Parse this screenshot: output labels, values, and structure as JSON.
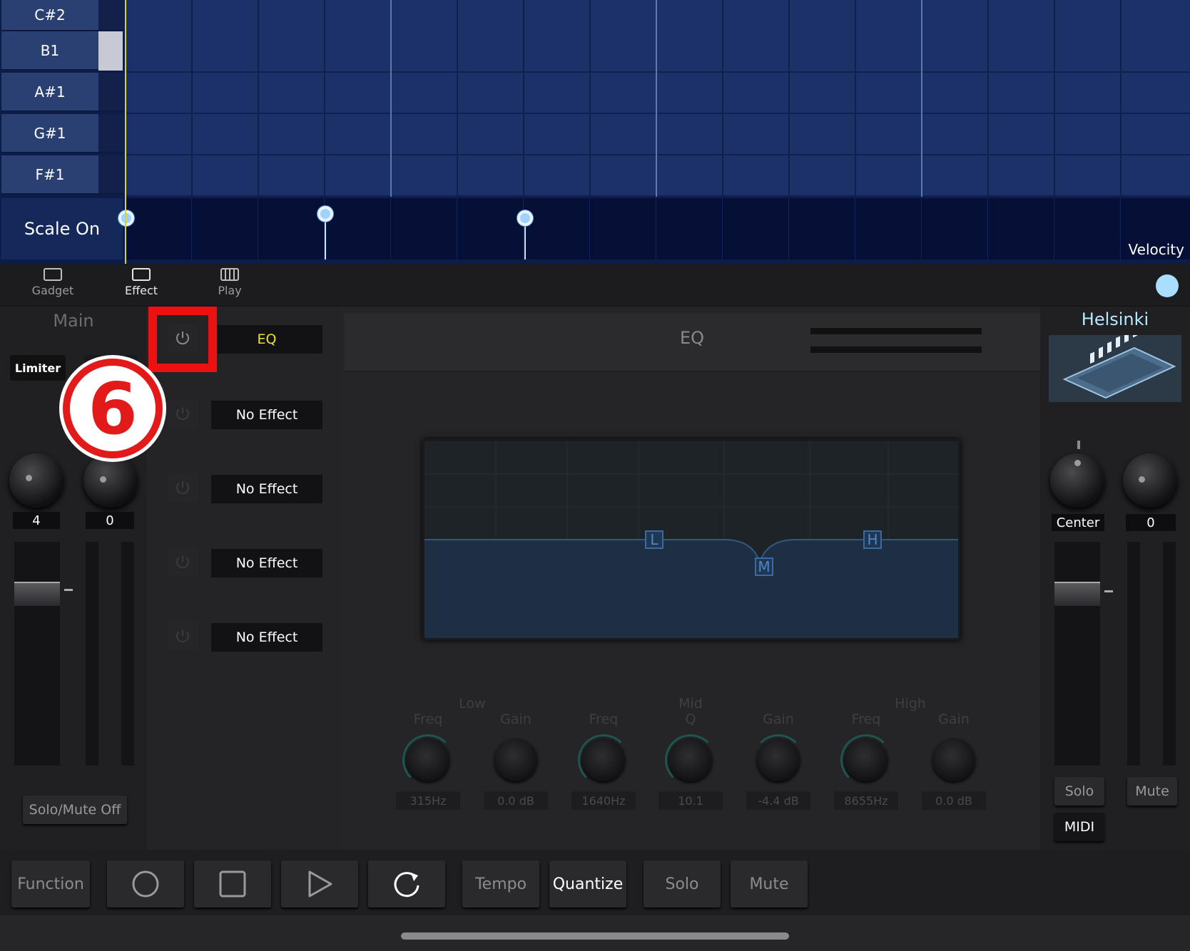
{
  "piano": {
    "keys": [
      "C#2",
      "B1",
      "A#1",
      "G#1",
      "F#1"
    ],
    "scale_button": "Scale On",
    "velocity_label": "Velocity"
  },
  "tabs": [
    {
      "label": "Gadget",
      "icon": "gadget-icon"
    },
    {
      "label": "Effect",
      "icon": "effect-icon"
    },
    {
      "label": "Play",
      "icon": "piano-keys-icon"
    }
  ],
  "main": {
    "title": "Main",
    "limiter_label": "Limiter",
    "knob_values": [
      "4",
      "0"
    ],
    "solo_mute_label": "Solo/Mute Off"
  },
  "effects": {
    "slots": [
      "EQ",
      "No Effect",
      "No Effect",
      "No Effect",
      "No Effect"
    ],
    "step_badge": "6"
  },
  "eq": {
    "title": "EQ",
    "points": [
      "L",
      "M",
      "H"
    ],
    "groups": [
      "Low",
      "Mid",
      "High"
    ],
    "params": [
      {
        "label": "Freq",
        "value": "315Hz"
      },
      {
        "label": "Gain",
        "value": "0.0 dB"
      },
      {
        "label": "Freq",
        "value": "1640Hz"
      },
      {
        "label": "Q",
        "value": "10.1"
      },
      {
        "label": "Gain",
        "value": "-4.4 dB"
      },
      {
        "label": "Freq",
        "value": "8655Hz"
      },
      {
        "label": "Gain",
        "value": "0.0 dB"
      }
    ]
  },
  "track": {
    "name": "Helsinki",
    "pan_value": "Center",
    "level_value": "0",
    "solo_label": "Solo",
    "mute_label": "Mute",
    "midi_label": "MIDI"
  },
  "transport": {
    "function_label": "Function",
    "tempo_label": "Tempo",
    "quantize_label": "Quantize",
    "solo_label": "Solo",
    "mute_label": "Mute"
  },
  "colors": {
    "accent_yellow": "#e8e23a",
    "highlight_red": "#ee1111",
    "track_name": "#b8e8ff"
  }
}
